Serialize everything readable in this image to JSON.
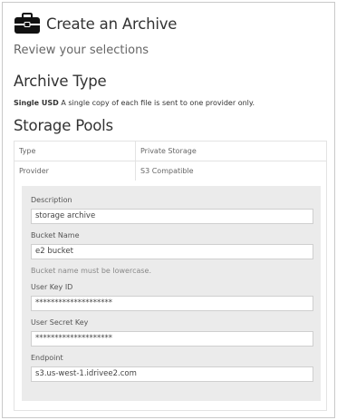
{
  "header": {
    "icon": "briefcase-icon",
    "title": "Create an Archive",
    "subtitle": "Review your selections"
  },
  "archive_type": {
    "heading": "Archive Type",
    "name": "Single USD",
    "description": "A single copy of each file is sent to one provider only."
  },
  "storage_pools": {
    "heading": "Storage Pools",
    "rows": [
      {
        "key": "Type",
        "value": "Private Storage"
      },
      {
        "key": "Provider",
        "value": "S3 Compatible"
      }
    ],
    "fields": {
      "description": {
        "label": "Description",
        "value": "storage archive"
      },
      "bucket_name": {
        "label": "Bucket Name",
        "value": "e2 bucket",
        "help": "Bucket name must be lowercase."
      },
      "user_key_id": {
        "label": "User Key ID",
        "value": "********************"
      },
      "user_secret_key": {
        "label": "User Secret Key",
        "value": "********************"
      },
      "endpoint": {
        "label": "Endpoint",
        "value": "s3.us-west-1.idrivee2.com"
      }
    }
  }
}
